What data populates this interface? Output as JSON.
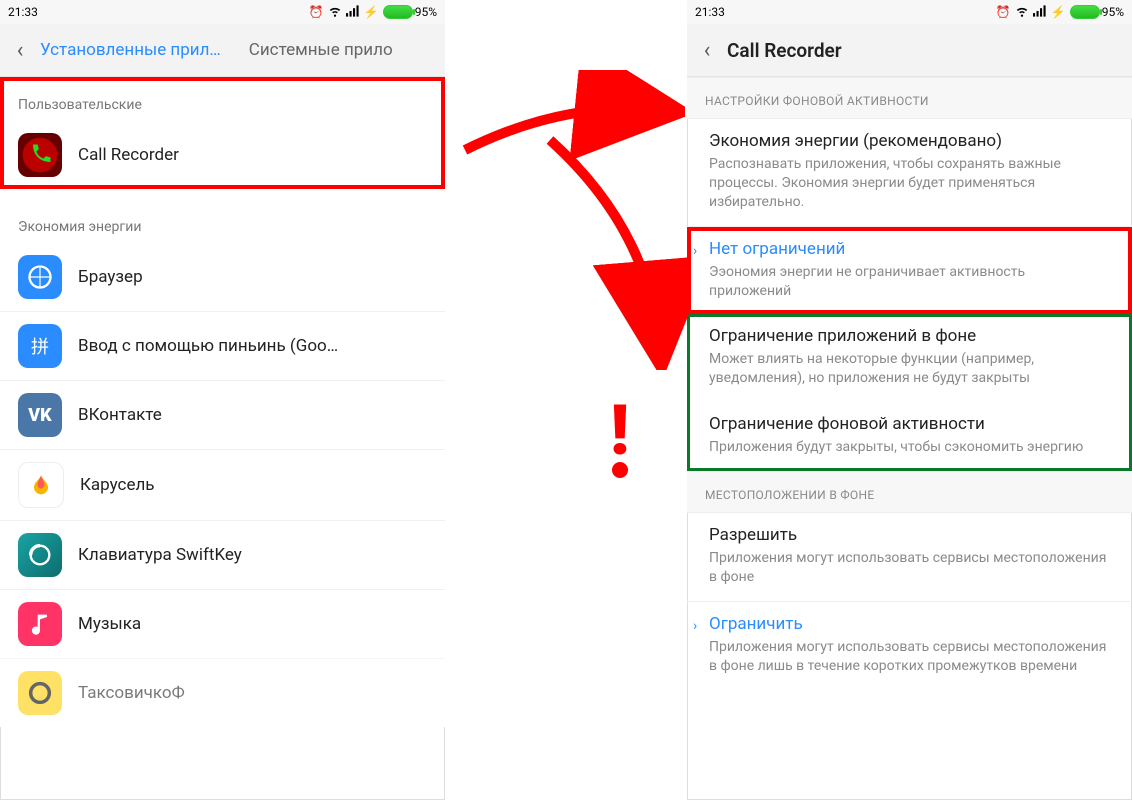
{
  "status": {
    "time": "21:33",
    "battery_pct": "95%"
  },
  "left": {
    "tabs": {
      "active": "Установленные прил…",
      "inactive": "Системные прило"
    },
    "user_section_label": "Пользовательские",
    "user_apps": [
      {
        "name": "Call Recorder"
      }
    ],
    "energy_section_label": "Экономия энергии",
    "apps": [
      {
        "name": "Браузер"
      },
      {
        "name": "Ввод с помощью пиньинь (Goo…"
      },
      {
        "name": "ВКонтакте"
      },
      {
        "name": "Карусель"
      },
      {
        "name": "Клавиатура SwiftKey"
      },
      {
        "name": "Музыка"
      },
      {
        "name": "ТаксовичкоФ"
      }
    ]
  },
  "right": {
    "title": "Call Recorder",
    "bg_section_label": "НАСТРОЙКИ ФОНОВОЙ АКТИВНОСТИ",
    "options": [
      {
        "title": "Экономия энергии (рекомендовано)",
        "desc": "Распознавать приложения, чтобы сохранять важные процессы.\nЭкономия энергии будет применяться избирательно."
      },
      {
        "title": "Нет ограничений",
        "desc": "Ээономия энергии не ограничивает активность приложений"
      },
      {
        "title": "Ограничение приложений в фоне",
        "desc": "Может влиять на некоторые функции (например, уведомления), но приложения не будут закрыты"
      },
      {
        "title": "Ограничение фоновой активности",
        "desc": "Приложения будут закрыты, чтобы сэкономить энергию"
      }
    ],
    "loc_section_label": "МЕСТОПОЛОЖЕНИИ В ФОНЕ",
    "loc_options": [
      {
        "title": "Разрешить",
        "desc": "Приложения могут использовать сервисы местоположения в фоне"
      },
      {
        "title": "Ограничить",
        "desc": "Приложения могут использовать сервисы местоположения в фоне лишь в течение коротких промежутков времени"
      }
    ]
  }
}
